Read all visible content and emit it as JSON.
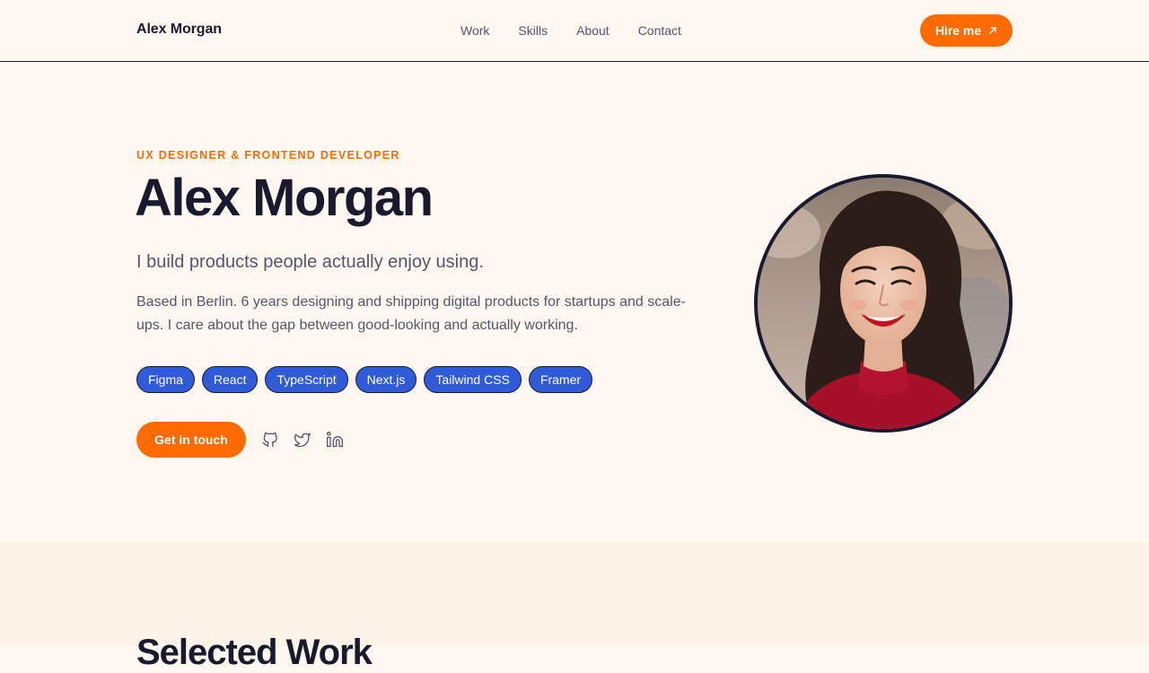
{
  "header": {
    "brand": "Alex Morgan",
    "nav": [
      "Work",
      "Skills",
      "About",
      "Contact"
    ],
    "hire_label": "Hire me",
    "hire_icon": "arrow-up-right-icon"
  },
  "hero": {
    "eyebrow": "UX DESIGNER & FRONTEND DEVELOPER",
    "name": "Alex Morgan",
    "tagline": "I build products people actually enjoy using.",
    "bio": "Based in Berlin. 6 years designing and shipping digital products for startups and scale-ups. I care about the gap between good-looking and actually working.",
    "skills": [
      "Figma",
      "React",
      "TypeScript",
      "Next.js",
      "Tailwind CSS",
      "Framer"
    ],
    "cta_label": "Get in touch",
    "social_icons": [
      "github-icon",
      "twitter-icon",
      "linkedin-icon"
    ],
    "portrait_alt": "portrait-photo"
  },
  "work": {
    "title": "Selected Work"
  },
  "colors": {
    "background": "#fff8f0",
    "accent": "#ff6b00",
    "chip": "#2f5bd9",
    "text": "#1a1a2e",
    "muted": "#55556a"
  }
}
